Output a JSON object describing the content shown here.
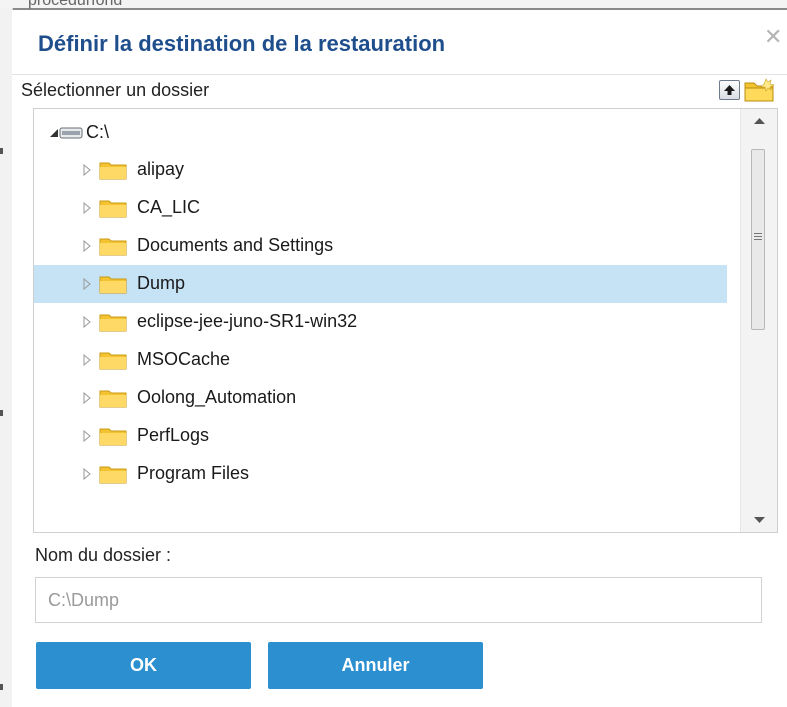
{
  "background": {
    "fragment_text": "procédurfond"
  },
  "dialog": {
    "title": "Définir la destination de la restauration",
    "close_glyph": "✕",
    "select_folder_label": "Sélectionner un dossier",
    "toolbar_icons": [
      "up-arrow-icon",
      "new-folder-icon"
    ],
    "tree": {
      "root": {
        "label": "C:\\",
        "expanded": true,
        "icon": "drive-icon"
      },
      "items": [
        {
          "label": "alipay",
          "selected": false
        },
        {
          "label": "CA_LIC",
          "selected": false
        },
        {
          "label": "Documents and Settings",
          "selected": false
        },
        {
          "label": "Dump",
          "selected": true
        },
        {
          "label": "eclipse-jee-juno-SR1-win32",
          "selected": false
        },
        {
          "label": "MSOCache",
          "selected": false
        },
        {
          "label": "Oolong_Automation",
          "selected": false
        },
        {
          "label": "PerfLogs",
          "selected": false
        },
        {
          "label": "Program Files",
          "selected": false
        }
      ]
    },
    "folder_name_label": "Nom du dossier :",
    "folder_name_value": "",
    "folder_name_placeholder": "C:\\Dump",
    "ok_label": "OK",
    "cancel_label": "Annuler"
  },
  "colors": {
    "title": "#1f4e8c",
    "selection": "#c6e2f5",
    "button": "#2b8fd0",
    "folder": "#f4c430"
  }
}
